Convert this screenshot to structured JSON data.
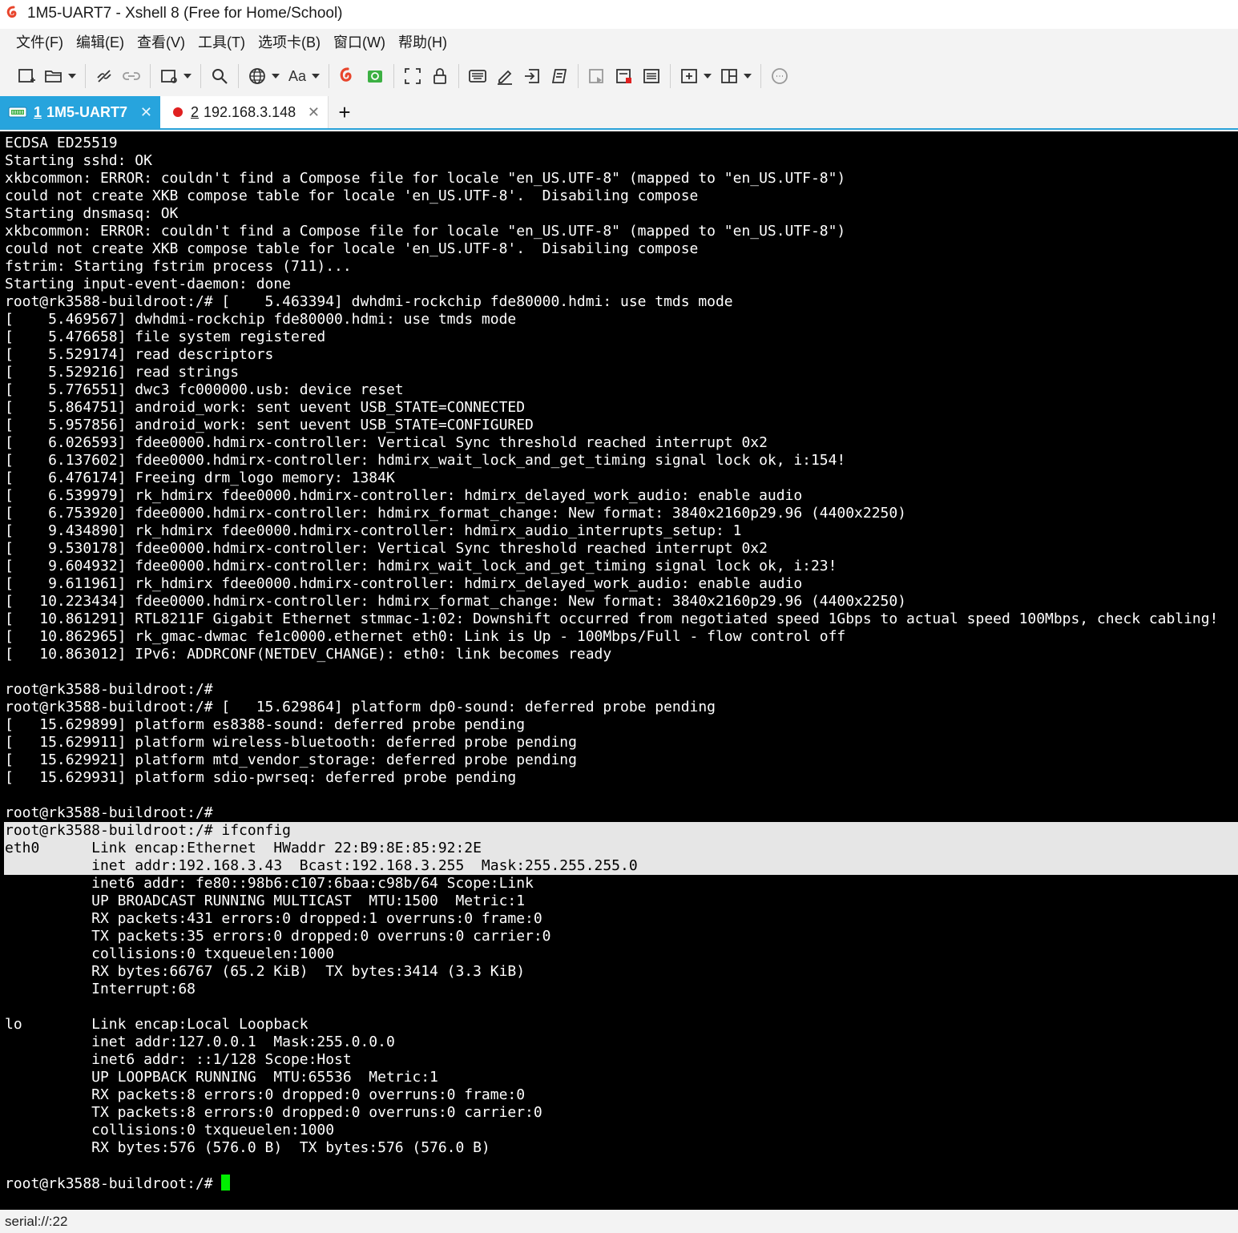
{
  "window": {
    "title": "1M5-UART7 - Xshell 8 (Free for Home/School)"
  },
  "menu": [
    "文件(F)",
    "编辑(E)",
    "查看(V)",
    "工具(T)",
    "选项卡(B)",
    "窗口(W)",
    "帮助(H)"
  ],
  "toolbar": {
    "font_label": "Aa"
  },
  "tabs": [
    {
      "num": "1",
      "label": "1M5-UART7",
      "active": true
    },
    {
      "num": "2",
      "label": "192.168.3.148",
      "active": false,
      "status_color": "#e02020"
    }
  ],
  "add_tab_label": "+",
  "colors": {
    "accent": "#27a4dd",
    "cursor": "#00ee00",
    "terminal_bg": "#000000"
  },
  "terminal": {
    "lines": [
      "ECDSA ED25519",
      "Starting sshd: OK",
      "xkbcommon: ERROR: couldn't find a Compose file for locale \"en_US.UTF-8\" (mapped to \"en_US.UTF-8\")",
      "could not create XKB compose table for locale 'en_US.UTF-8'.  Disabiling compose",
      "Starting dnsmasq: OK",
      "xkbcommon: ERROR: couldn't find a Compose file for locale \"en_US.UTF-8\" (mapped to \"en_US.UTF-8\")",
      "could not create XKB compose table for locale 'en_US.UTF-8'.  Disabiling compose",
      "fstrim: Starting fstrim process (711)...",
      "Starting input-event-daemon: done",
      "root@rk3588-buildroot:/# [    5.463394] dwhdmi-rockchip fde80000.hdmi: use tmds mode",
      "[    5.469567] dwhdmi-rockchip fde80000.hdmi: use tmds mode",
      "[    5.476658] file system registered",
      "[    5.529174] read descriptors",
      "[    5.529216] read strings",
      "[    5.776551] dwc3 fc000000.usb: device reset",
      "[    5.864751] android_work: sent uevent USB_STATE=CONNECTED",
      "[    5.957856] android_work: sent uevent USB_STATE=CONFIGURED",
      "[    6.026593] fdee0000.hdmirx-controller: Vertical Sync threshold reached interrupt 0x2",
      "[    6.137602] fdee0000.hdmirx-controller: hdmirx_wait_lock_and_get_timing signal lock ok, i:154!",
      "[    6.476174] Freeing drm_logo memory: 1384K",
      "[    6.539979] rk_hdmirx fdee0000.hdmirx-controller: hdmirx_delayed_work_audio: enable audio",
      "[    6.753920] fdee0000.hdmirx-controller: hdmirx_format_change: New format: 3840x2160p29.96 (4400x2250)",
      "[    9.434890] rk_hdmirx fdee0000.hdmirx-controller: hdmirx_audio_interrupts_setup: 1",
      "[    9.530178] fdee0000.hdmirx-controller: Vertical Sync threshold reached interrupt 0x2",
      "[    9.604932] fdee0000.hdmirx-controller: hdmirx_wait_lock_and_get_timing signal lock ok, i:23!",
      "[    9.611961] rk_hdmirx fdee0000.hdmirx-controller: hdmirx_delayed_work_audio: enable audio",
      "[   10.223434] fdee0000.hdmirx-controller: hdmirx_format_change: New format: 3840x2160p29.96 (4400x2250)",
      "[   10.861291] RTL8211F Gigabit Ethernet stmmac-1:02: Downshift occurred from negotiated speed 1Gbps to actual speed 100Mbps, check cabling!",
      "[   10.862965] rk_gmac-dwmac fe1c0000.ethernet eth0: Link is Up - 100Mbps/Full - flow control off",
      "[   10.863012] IPv6: ADDRCONF(NETDEV_CHANGE): eth0: link becomes ready",
      "",
      "root@rk3588-buildroot:/#",
      "root@rk3588-buildroot:/# [   15.629864] platform dp0-sound: deferred probe pending",
      "[   15.629899] platform es8388-sound: deferred probe pending",
      "[   15.629911] platform wireless-bluetooth: deferred probe pending",
      "[   15.629921] platform mtd_vendor_storage: deferred probe pending",
      "[   15.629931] platform sdio-pwrseq: deferred probe pending",
      "",
      "root@rk3588-buildroot:/#",
      "root@rk3588-buildroot:/# ifconfig",
      "eth0      Link encap:Ethernet  HWaddr 22:B9:8E:85:92:2E",
      "          inet addr:192.168.3.43  Bcast:192.168.3.255  Mask:255.255.255.0",
      "          inet6 addr: fe80::98b6:c107:6baa:c98b/64 Scope:Link",
      "          UP BROADCAST RUNNING MULTICAST  MTU:1500  Metric:1",
      "          RX packets:431 errors:0 dropped:1 overruns:0 frame:0",
      "          TX packets:35 errors:0 dropped:0 overruns:0 carrier:0",
      "          collisions:0 txqueuelen:1000",
      "          RX bytes:66767 (65.2 KiB)  TX bytes:3414 (3.3 KiB)",
      "          Interrupt:68",
      "",
      "lo        Link encap:Local Loopback",
      "          inet addr:127.0.0.1  Mask:255.0.0.0",
      "          inet6 addr: ::1/128 Scope:Host",
      "          UP LOOPBACK RUNNING  MTU:65536  Metric:1",
      "          RX packets:8 errors:0 dropped:0 overruns:0 frame:0",
      "          TX packets:8 errors:0 dropped:0 overruns:0 carrier:0",
      "          collisions:0 txqueuelen:1000",
      "          RX bytes:576 (576.0 B)  TX bytes:576 (576.0 B)",
      "",
      "root@rk3588-buildroot:/# "
    ]
  },
  "statusbar": {
    "text": "serial://:22"
  }
}
